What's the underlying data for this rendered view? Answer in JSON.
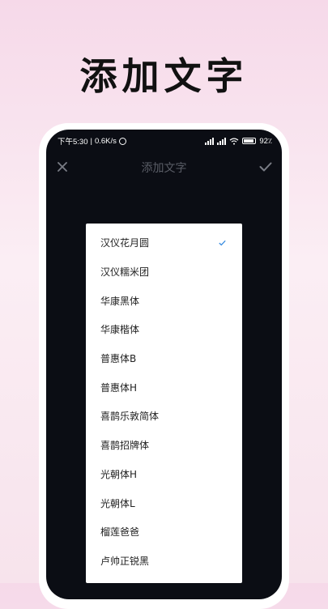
{
  "promo": {
    "title": "添加文字"
  },
  "status_bar": {
    "time": "下午5:30",
    "speed": "0.6K/s",
    "battery_level": "92"
  },
  "header": {
    "title": "添加文字"
  },
  "font_menu": {
    "selected_index": 0,
    "check_color": "#3a8de0",
    "items": [
      {
        "label": "汉仪花月圆"
      },
      {
        "label": "汉仪糯米团"
      },
      {
        "label": "华康黑体"
      },
      {
        "label": "华康楷体"
      },
      {
        "label": "普惠体B"
      },
      {
        "label": "普惠体H"
      },
      {
        "label": "喜鹊乐敦简体"
      },
      {
        "label": "喜鹊招牌体"
      },
      {
        "label": "光朝体H"
      },
      {
        "label": "光朝体L"
      },
      {
        "label": "榴莲爸爸"
      },
      {
        "label": "卢帅正锐黑"
      }
    ]
  }
}
